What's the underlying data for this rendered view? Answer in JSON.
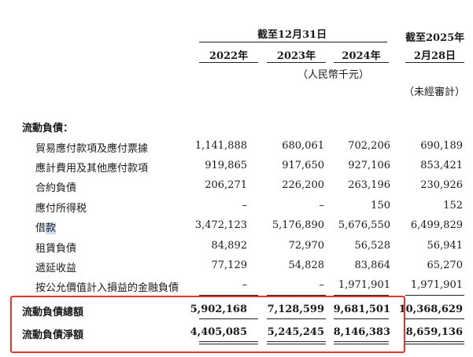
{
  "header": {
    "group_title": "截至12月31日",
    "years": [
      "2022年",
      "2023年",
      "2024年"
    ],
    "last_col_line1": "截至2025年",
    "last_col_line2": "2月28日",
    "unit": "（人民幣千元）",
    "unaudited": "（未經審計）"
  },
  "section_title": "流動負債：",
  "rows": [
    {
      "label": "貿易應付款項及應付票據",
      "values": [
        "1,141,888",
        "680,061",
        "702,206",
        "690,189"
      ]
    },
    {
      "label": "應計費用及其他應付款項",
      "values": [
        "919,865",
        "917,650",
        "927,106",
        "853,421"
      ]
    },
    {
      "label": "合約負債",
      "values": [
        "206,271",
        "226,200",
        "263,196",
        "230,926"
      ]
    },
    {
      "label": "應付所得税",
      "values": [
        "–",
        "–",
        "150",
        "152"
      ]
    },
    {
      "label_a": "借",
      "label_b": "款",
      "values": [
        "3,472,123",
        "5,176,890",
        "5,676,550",
        "6,499,829"
      ]
    },
    {
      "label": "租賃負債",
      "values": [
        "84,892",
        "72,970",
        "56,528",
        "56,941"
      ]
    },
    {
      "label": "遞延收益",
      "values": [
        "77,129",
        "54,828",
        "83,864",
        "65,270"
      ]
    },
    {
      "label": "按公允價值計入損益的金融負債",
      "values": [
        "–",
        "–",
        "1,971,901",
        "1,971,901"
      ]
    }
  ],
  "totals": [
    {
      "label": "流動負債總額",
      "values": [
        "5,902,168",
        "7,128,599",
        "9,681,501",
        "10,368,629"
      ]
    },
    {
      "label": "流動負債淨額",
      "values": [
        "4,405,085",
        "5,245,245",
        "8,146,383",
        "8,659,136"
      ]
    }
  ]
}
